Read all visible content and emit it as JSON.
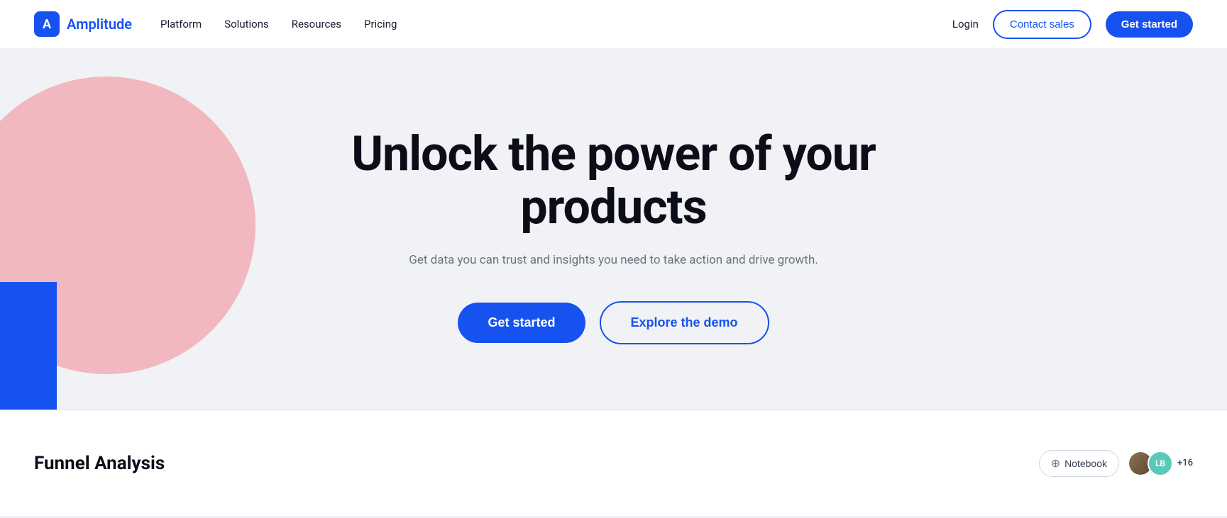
{
  "brand": {
    "name": "Amplitude",
    "logo_letter": "A"
  },
  "navbar": {
    "links": [
      {
        "label": "Platform",
        "id": "platform"
      },
      {
        "label": "Solutions",
        "id": "solutions"
      },
      {
        "label": "Resources",
        "id": "resources"
      },
      {
        "label": "Pricing",
        "id": "pricing"
      }
    ],
    "login_label": "Login",
    "contact_sales_label": "Contact sales",
    "get_started_label": "Get started"
  },
  "hero": {
    "title": "Unlock the power of your products",
    "subtitle": "Get data you can trust and insights you need to take action and drive growth.",
    "get_started_label": "Get started",
    "explore_demo_label": "Explore the demo"
  },
  "bottom_strip": {
    "title": "Funnel Analysis",
    "notebook_label": "Notebook",
    "avatar_initials": "LB",
    "extra_count": "+16"
  },
  "colors": {
    "brand_blue": "#1652f0",
    "pink": "#f2b8c0",
    "bg": "#f0f2f5"
  }
}
